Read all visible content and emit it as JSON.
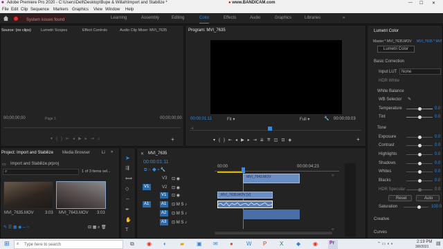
{
  "window": {
    "title": "Adobe Premiere Pro 2020 - C:\\Users\\Dell\\Desktop\\Bupe & Willah\\Import and Stabilize *",
    "watermark": "www.BANDICAM.com"
  },
  "menu": [
    "File",
    "Edit",
    "Clip",
    "Sequence",
    "Markers",
    "Graphics",
    "View",
    "Window",
    "Help"
  ],
  "workspaces": {
    "issue_badge": "System issues found",
    "tabs": [
      "Learning",
      "Assembly",
      "Editing",
      "Color",
      "Effects",
      "Audio",
      "Graphics",
      "Libraries"
    ],
    "active": "Color"
  },
  "source_panel": {
    "tabs": [
      "Source: (no clips)",
      "Lumetri Scopes",
      "Effect Controls",
      "Audio Clip Mixer: MVI_7635"
    ],
    "timecode_left": "00;00;00;00",
    "timecode_right": "00;00;00;00",
    "page_label": "Page 1"
  },
  "program_panel": {
    "title": "Program: MVI_7635",
    "timecode": "00:00:01:11",
    "fit": "Fit",
    "quality": "Full",
    "duration": "00:00:03:03"
  },
  "lumetri": {
    "tab": "Lumetri Color",
    "master": "Master * MVI_7635.MOV",
    "clip": "MVI_7635 * MVI",
    "preset": "Lumetri Color",
    "sections": {
      "basic": "Basic Correction",
      "white_balance": "White Balance",
      "tone": "Tone",
      "creative": "Creative",
      "curves": "Curves"
    },
    "input_lut_label": "Input LUT",
    "input_lut_value": "None",
    "hdr_white": "HDR White",
    "wb_selector": "WB Selector",
    "sliders": [
      {
        "label": "Temperature",
        "value": "0.0",
        "level": 0.5
      },
      {
        "label": "Tint",
        "value": "0.0",
        "level": 0.5
      },
      {
        "label": "Exposure",
        "value": "0.0",
        "level": 0.5
      },
      {
        "label": "Contrast",
        "value": "0.0",
        "level": 0.5
      },
      {
        "label": "Highlights",
        "value": "0.0",
        "level": 0.5
      },
      {
        "label": "Shadows",
        "value": "0.0",
        "level": 0.5
      },
      {
        "label": "Whites",
        "value": "0.0",
        "level": 0.5
      },
      {
        "label": "Blacks",
        "value": "0.0",
        "level": 0.5
      },
      {
        "label": "HDR Specular",
        "value": "0.0",
        "level": 0.5
      }
    ],
    "reset": "Reset",
    "auto": "Auto",
    "saturation_label": "Saturation",
    "saturation_value": "100.0"
  },
  "project_panel": {
    "tabs": [
      "Project: Import and Stabilize",
      "Media Browser",
      "Li"
    ],
    "file": "Import and Stabilize.prproj",
    "items_count": "1 of 3 items sel...",
    "clips": [
      {
        "name": "MVI_7635.MOV",
        "duration": "3:03"
      },
      {
        "name": "MVI_7643.MOV",
        "duration": "3:03"
      }
    ]
  },
  "timeline": {
    "tab": "MVI_7635",
    "timecode": "00:00:01:11",
    "ruler_start": "00:00",
    "ruler_end": "00:00:04:23",
    "tracks": [
      "V3",
      "V2",
      "V1",
      "A1",
      "A2",
      "A3"
    ],
    "source_patch_v": "V1",
    "source_patch_a": "A1",
    "clips": [
      {
        "label": "MVI_7643.MOV",
        "track": "V2"
      },
      {
        "label": "MVI_7635.MOV [V]",
        "track": "V1"
      }
    ]
  },
  "taskbar": {
    "search": "Type here to search",
    "time": "2:19 PM",
    "date": "3/8/2021"
  }
}
